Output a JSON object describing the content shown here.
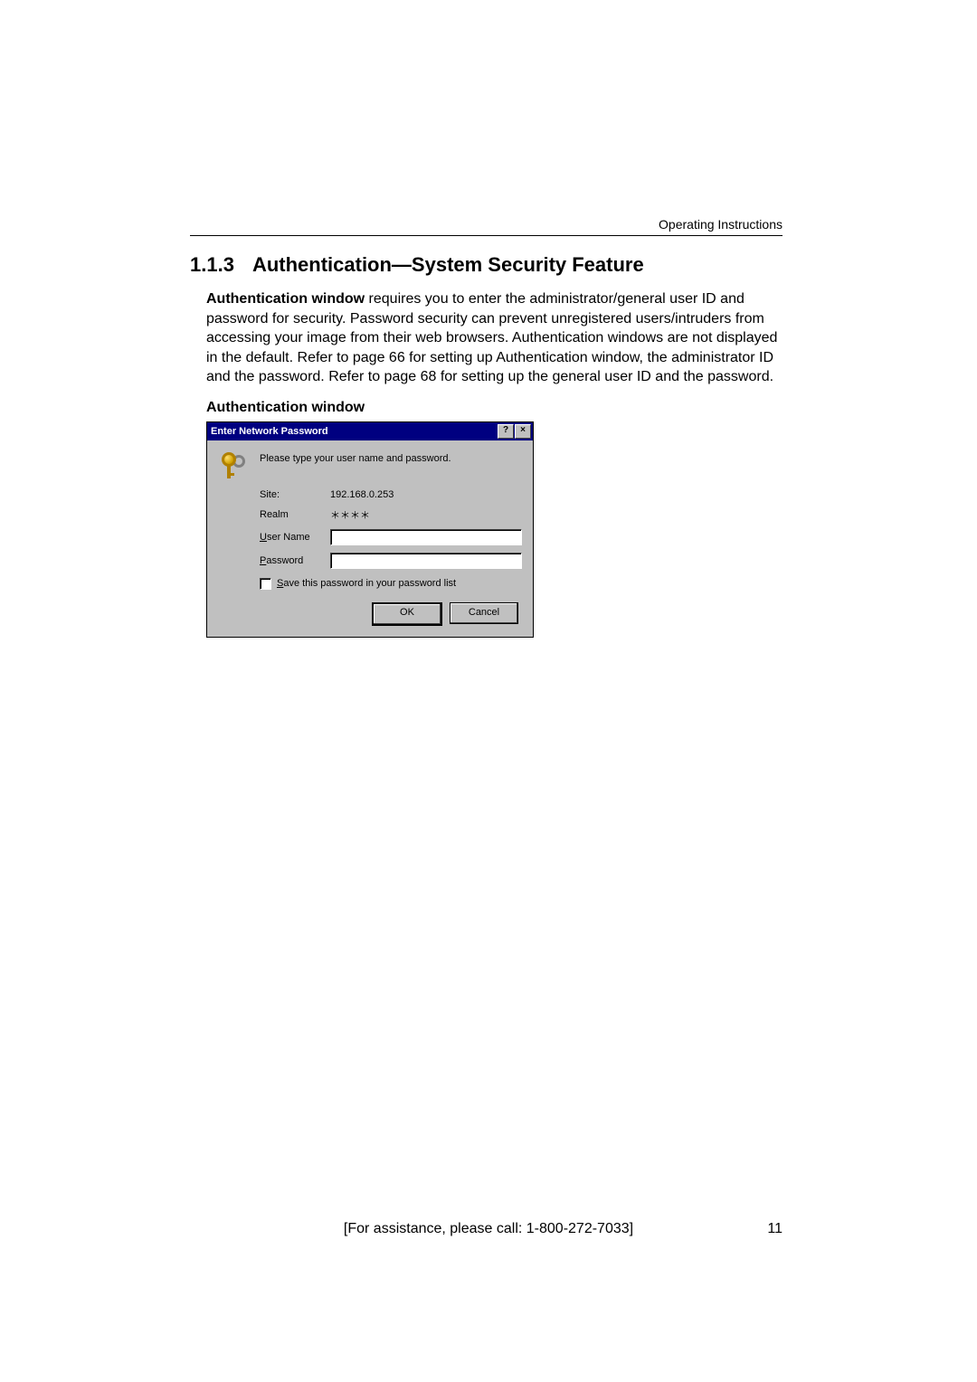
{
  "header_label": "Operating Instructions",
  "section": {
    "number": "1.1.3",
    "title": "Authentication—System Security Feature"
  },
  "paragraph": {
    "lead_bold": "Authentication window",
    "rest": " requires you to enter the administrator/general user ID and password for security. Password security can prevent unregistered users/intruders from accessing your image from their web browsers. Authentication windows are not displayed in the default. Refer to page 66 for setting up Authentication window, the administrator ID and the password. Refer to page 68 for setting up the general user ID and the password."
  },
  "sub_heading": "Authentication window",
  "dialog": {
    "title": "Enter Network Password",
    "help_btn": "?",
    "close_btn": "×",
    "instruction": "Please type your user name and password.",
    "site_label": "Site:",
    "site_value": "192.168.0.253",
    "realm_label": "Realm",
    "realm_value": "＊＊＊＊",
    "username_label_u": "U",
    "username_label_rest": "ser Name",
    "username_value": "",
    "password_label_u": "P",
    "password_label_rest": "assword",
    "password_value": "",
    "save_label_u": "S",
    "save_label_rest": "ave this password in your password list",
    "ok_label": "OK",
    "cancel_label": "Cancel"
  },
  "footer": "[For assistance, please call: 1-800-272-7033]",
  "page_number": "11"
}
